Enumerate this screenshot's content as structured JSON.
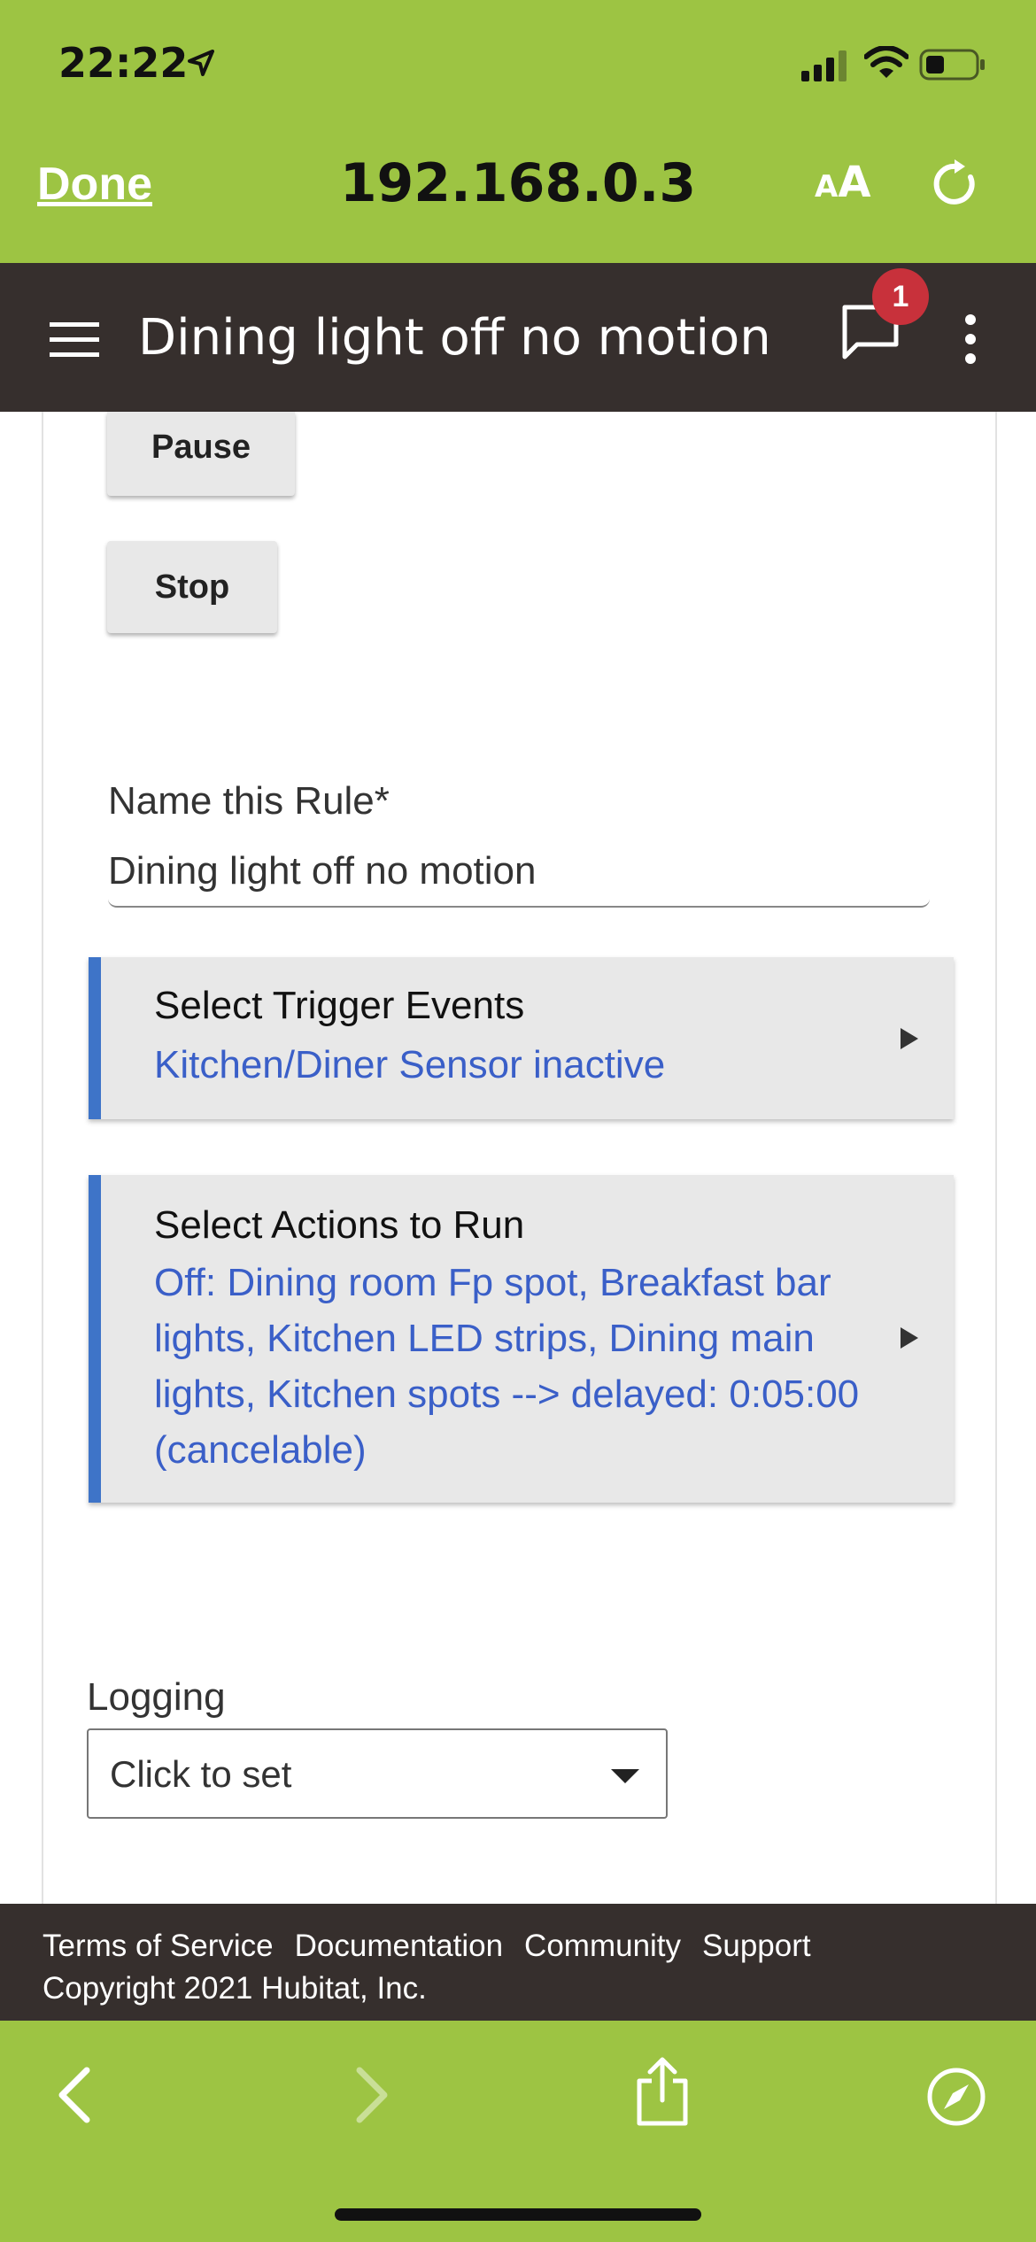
{
  "status": {
    "time": "22:22"
  },
  "safari": {
    "done_label": "Done",
    "url": "192.168.0.3",
    "text_size_small": "A",
    "text_size_big": "A"
  },
  "app": {
    "title": "Dining light off no motion",
    "notification_count": "1"
  },
  "controls": {
    "pause_label": "Pause",
    "stop_label": "Stop"
  },
  "rule_name": {
    "label": "Name this Rule*",
    "value": "Dining light off no motion"
  },
  "trigger": {
    "title": "Select Trigger Events",
    "summary": "Kitchen/Diner Sensor inactive"
  },
  "actions": {
    "title": "Select Actions to Run",
    "summary": "Off: Dining room Fp spot, Breakfast bar lights, Kitchen LED strips, Dining main lights, Kitchen spots --> delayed: 0:05:00 (cancelable)"
  },
  "logging": {
    "label": "Logging",
    "value": "Click to set"
  },
  "footer": {
    "links": [
      "Terms of Service",
      "Documentation",
      "Community",
      "Support"
    ],
    "copyright": "Copyright 2021 Hubitat, Inc."
  },
  "colors": {
    "safari_green": "#9dc443",
    "header_dark": "#362f2d",
    "accent_blue": "#3e74c8",
    "badge_red": "#c8313b"
  }
}
